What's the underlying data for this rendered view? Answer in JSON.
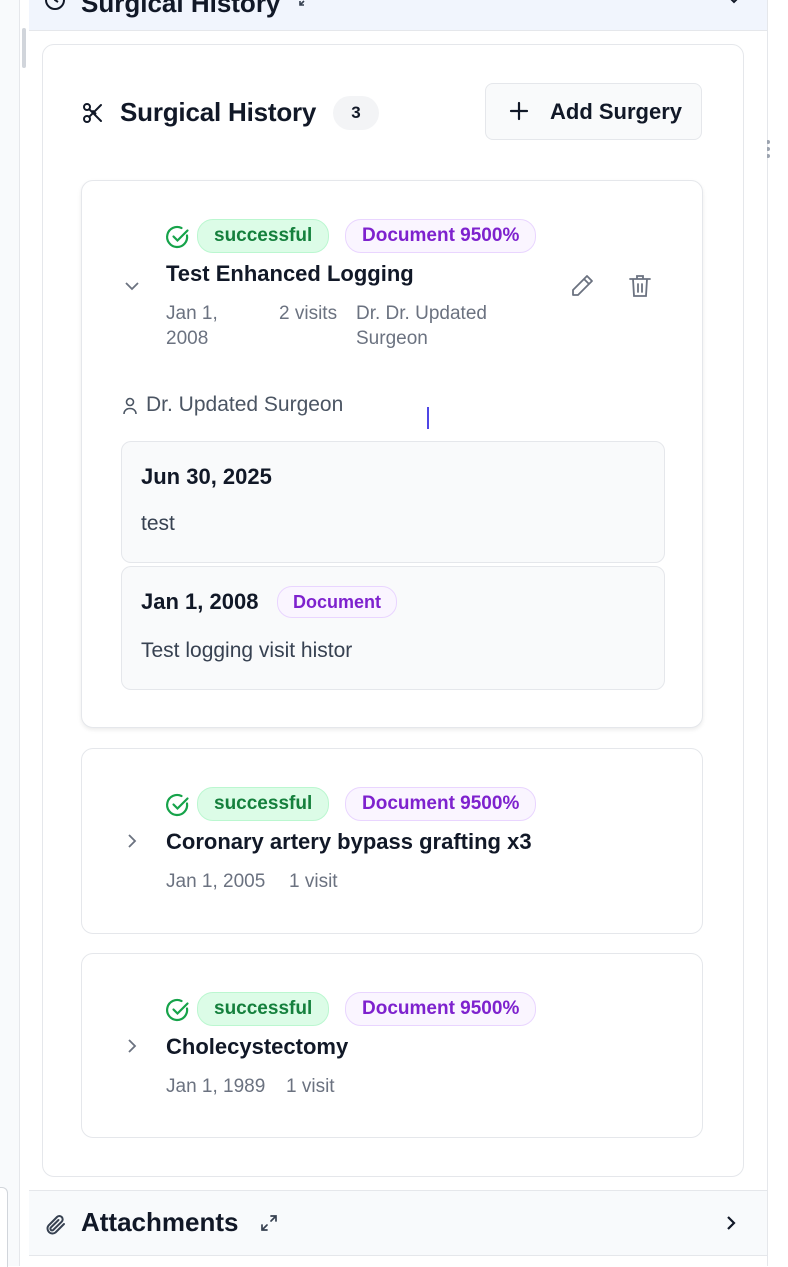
{
  "top_section": {
    "title": "Surgical History"
  },
  "surgical_history": {
    "title": "Surgical History",
    "count": "3",
    "add_button_label": "Add Surgery"
  },
  "surgeries": [
    {
      "status": "successful",
      "source": "Document 9500%",
      "title": "Test Enhanced Logging",
      "date": "Jan 1, 2008",
      "visits": "2 visits",
      "surgeon": "Dr. Dr. Updated Surgeon",
      "expanded": true,
      "surgeon_detail": "Dr. Updated Surgeon",
      "visit_entries": [
        {
          "date": "Jun 30, 2025",
          "note": "test",
          "badge": ""
        },
        {
          "date": "Jan 1, 2008",
          "note": "Test logging visit histor",
          "badge": "Document"
        }
      ]
    },
    {
      "status": "successful",
      "source": "Document 9500%",
      "title": "Coronary artery bypass grafting x3",
      "date": "Jan 1, 2005",
      "visits": "1 visit",
      "expanded": false
    },
    {
      "status": "successful",
      "source": "Document 9500%",
      "title": "Cholecystectomy",
      "date": "Jan 1, 1989",
      "visits": "1 visit",
      "expanded": false
    }
  ],
  "attachments": {
    "title": "Attachments"
  },
  "colors": {
    "success_green": "#15803d",
    "document_purple": "#7e22ce",
    "header_bg": "#f1f5fd"
  }
}
